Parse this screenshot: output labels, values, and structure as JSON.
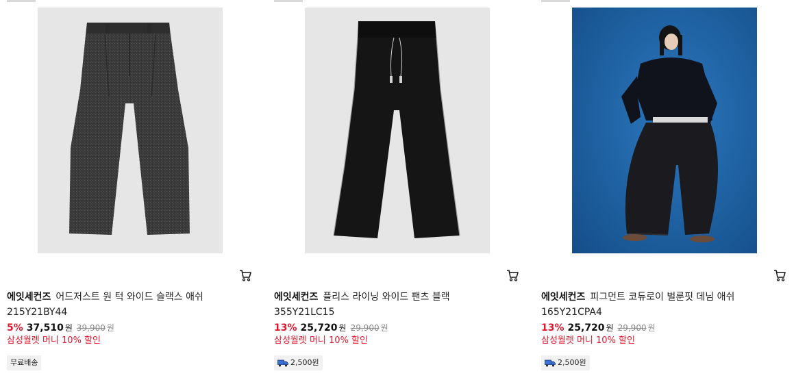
{
  "products": [
    {
      "brand": "에잇세컨즈",
      "name": "어드저스트 원 턱 와이드 슬랙스 애쉬",
      "code": "215Y21BY44",
      "discount": "5%",
      "price": "37,510",
      "price_unit": "원",
      "original_price": "39,900",
      "original_unit": "원",
      "promo": "삼성월렛 머니 10% 할인",
      "shipping": "무료배송",
      "shipping_icon": "",
      "image": "grey-tweed-wide-slacks"
    },
    {
      "brand": "에잇세컨즈",
      "name": "플리스 라이닝 와이드 팬츠 블랙",
      "code": "355Y21LC15",
      "discount": "13%",
      "price": "25,720",
      "price_unit": "원",
      "original_price": "29,900",
      "original_unit": "원",
      "promo": "삼성월렛 머니 10% 할인",
      "shipping": "2,500원",
      "shipping_icon": "truck-icon",
      "image": "black-wide-track-pants"
    },
    {
      "brand": "에잇세컨즈",
      "name": "피그먼트 코듀로이 벌룬핏 데님 애쉬",
      "code": "165Y21CPA4",
      "discount": "13%",
      "price": "25,720",
      "price_unit": "원",
      "original_price": "29,900",
      "original_unit": "원",
      "promo": "삼성월렛 머니 10% 할인",
      "shipping": "2,500원",
      "shipping_icon": "truck-icon",
      "image": "model-balloon-fit-denim"
    }
  ],
  "colors": {
    "discount_red": "#e0182d",
    "badge_bg": "#f1f1f1",
    "photo_bg_grey": "#e6e6e6",
    "photo_bg_blue": "#1e5f9e"
  },
  "icons": {
    "cart": "cart-icon",
    "truck": "truck-icon"
  }
}
